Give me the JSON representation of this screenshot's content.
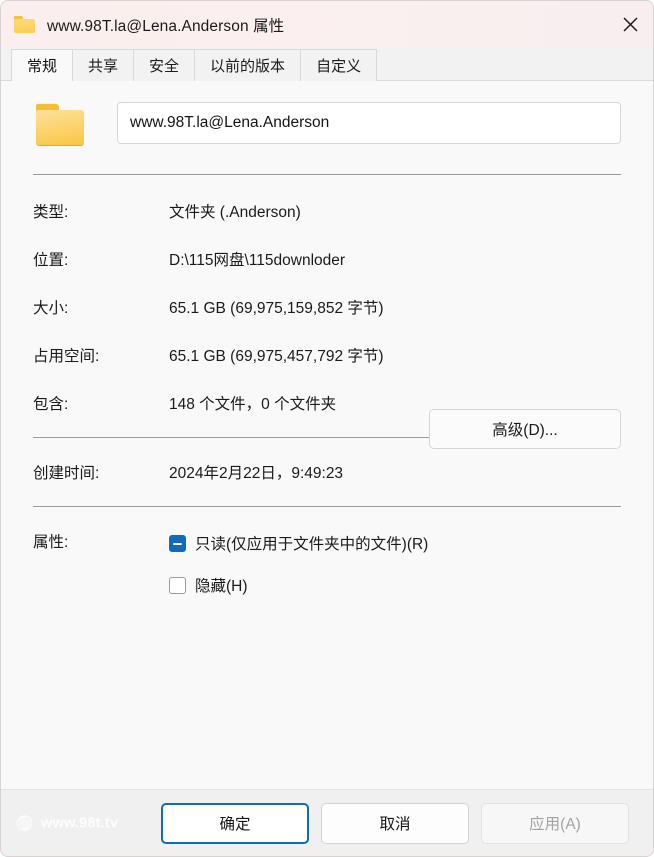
{
  "window": {
    "title": "www.98T.la@Lena.Anderson 属性",
    "folder_icon": "folder-icon",
    "close_icon": "close-icon"
  },
  "tabs": [
    {
      "label": "常规",
      "active": true
    },
    {
      "label": "共享",
      "active": false
    },
    {
      "label": "安全",
      "active": false
    },
    {
      "label": "以前的版本",
      "active": false
    },
    {
      "label": "自定义",
      "active": false
    }
  ],
  "name_field": {
    "value": "www.98T.la@Lena.Anderson",
    "icon": "folder-icon"
  },
  "properties": [
    {
      "label": "类型:",
      "value": "文件夹 (.Anderson)"
    },
    {
      "label": "位置:",
      "value": "D:\\115网盘\\115downloder"
    },
    {
      "label": "大小:",
      "value": "65.1 GB (69,975,159,852 字节)"
    },
    {
      "label": "占用空间:",
      "value": "65.1 GB (69,975,457,792 字节)"
    },
    {
      "label": "包含:",
      "value": "148 个文件，0 个文件夹"
    }
  ],
  "created": {
    "label": "创建时间:",
    "value": "2024年2月22日，9:49:23"
  },
  "attributes": {
    "label": "属性:",
    "readonly": {
      "label": "只读(仅应用于文件夹中的文件)(R)",
      "state": "indeterminate"
    },
    "hidden": {
      "label": "隐藏(H)",
      "state": "unchecked"
    },
    "advanced_button": "高级(D)..."
  },
  "footer": {
    "ok": "确定",
    "cancel": "取消",
    "apply": "应用(A)",
    "watermark_text": "www.98t.tv",
    "watermark_logo": "rose-logo-icon"
  },
  "colors": {
    "accent": "#0f6cbd",
    "titlebar": "#fbeeee",
    "content_bg": "#f9f9f9",
    "footer_bg": "#f0f0f0",
    "folder_yellow": "#fbcf55"
  }
}
